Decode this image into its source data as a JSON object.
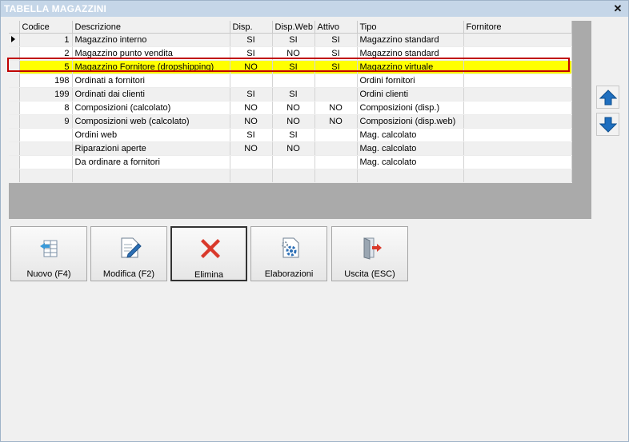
{
  "window": {
    "title": "TABELLA MAGAZZINI",
    "close_glyph": "✕"
  },
  "grid": {
    "columns": [
      "Codice",
      "Descrizione",
      "Disp.",
      "Disp.Web",
      "Attivo",
      "Tipo",
      "Fornitore"
    ],
    "rows": [
      {
        "codice": "1",
        "descrizione": "Magazzino interno",
        "disp": "SI",
        "dispweb": "SI",
        "attivo": "SI",
        "tipo": "Magazzino standard",
        "fornitore": ""
      },
      {
        "codice": "2",
        "descrizione": "Magazzino punto vendita",
        "disp": "SI",
        "dispweb": "NO",
        "attivo": "SI",
        "tipo": "Magazzino standard",
        "fornitore": ""
      },
      {
        "codice": "5",
        "descrizione": "Magazzino Fornitore (dropshipping)",
        "disp": "NO",
        "dispweb": "SI",
        "attivo": "SI",
        "tipo": "Magazzino virtuale",
        "fornitore": ""
      },
      {
        "codice": "198",
        "descrizione": "Ordinati a fornitori",
        "disp": "",
        "dispweb": "",
        "attivo": "",
        "tipo": "Ordini fornitori",
        "fornitore": ""
      },
      {
        "codice": "199",
        "descrizione": "Ordinati dai clienti",
        "disp": "SI",
        "dispweb": "SI",
        "attivo": "",
        "tipo": "Ordini clienti",
        "fornitore": ""
      },
      {
        "codice": "8",
        "descrizione": "Composizioni (calcolato)",
        "disp": "NO",
        "dispweb": "NO",
        "attivo": "NO",
        "tipo": "Composizioni (disp.)",
        "fornitore": ""
      },
      {
        "codice": "9",
        "descrizione": "Composizioni web (calcolato)",
        "disp": "NO",
        "dispweb": "NO",
        "attivo": "NO",
        "tipo": "Composizioni (disp.web)",
        "fornitore": ""
      },
      {
        "codice": "",
        "descrizione": "Ordini web",
        "disp": "SI",
        "dispweb": "SI",
        "attivo": "",
        "tipo": "Mag. calcolato",
        "fornitore": ""
      },
      {
        "codice": "",
        "descrizione": "Riparazioni aperte",
        "disp": "NO",
        "dispweb": "NO",
        "attivo": "",
        "tipo": "Mag. calcolato",
        "fornitore": ""
      },
      {
        "codice": "",
        "descrizione": "Da ordinare a fornitori",
        "disp": "",
        "dispweb": "",
        "attivo": "",
        "tipo": "Mag. calcolato",
        "fornitore": ""
      },
      {
        "codice": "",
        "descrizione": "",
        "disp": "",
        "dispweb": "",
        "attivo": "",
        "tipo": "",
        "fornitore": ""
      }
    ],
    "current_row_index": 0,
    "highlighted_row_index": 2,
    "colors": {
      "highlight": "#ffff00",
      "selection_border": "#c00000",
      "zebra": "#f0f0f0",
      "panel": "#aaaaaa"
    }
  },
  "side": {
    "up_icon": "arrow-up-icon",
    "down_icon": "arrow-down-icon",
    "accent": "#1f6fbf"
  },
  "toolbar": {
    "nuovo": {
      "label": "Nuovo (F4)",
      "icon": "new-record-icon"
    },
    "modifica": {
      "label": "Modifica (F2)",
      "icon": "edit-icon"
    },
    "elimina": {
      "label": "Elimina",
      "icon": "delete-icon",
      "color": "#d9392b"
    },
    "elaborazioni": {
      "label": "Elaborazioni",
      "icon": "process-gear-icon"
    },
    "uscita": {
      "label": "Uscita (ESC)",
      "icon": "exit-door-icon"
    }
  }
}
